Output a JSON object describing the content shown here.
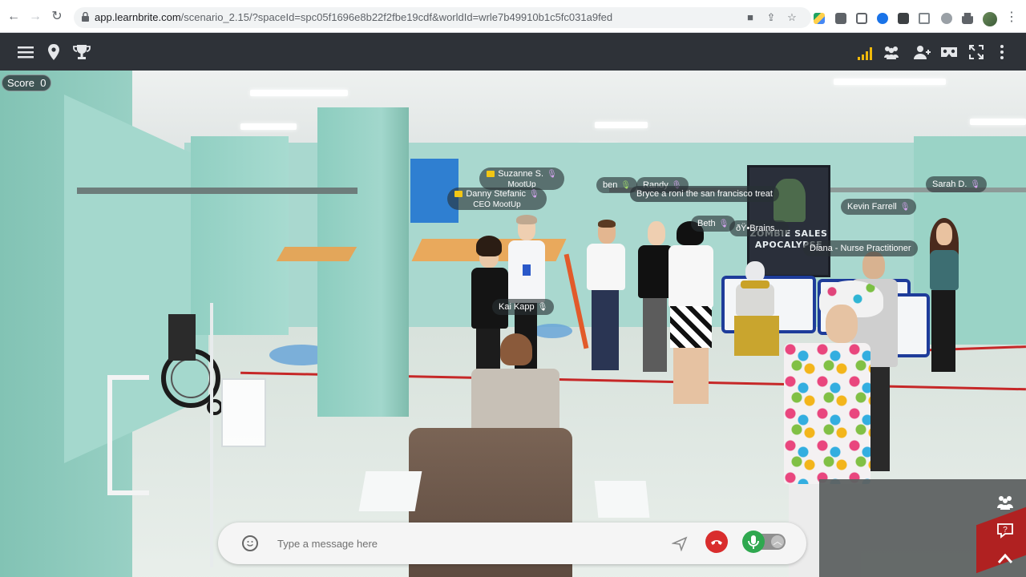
{
  "browser": {
    "url_host": "app.learnbrite.com",
    "url_rest": "/scenario_2.15/?spaceId=spc05f1696e8b22f2fbe19cdf&worldId=wrle7b49910b1c5fc031a9fed",
    "icons": [
      "back-arrow-icon",
      "forward-arrow-icon",
      "reload-icon",
      "lock-icon",
      "camera-icon",
      "share-icon",
      "star-icon",
      "google-drive-icon",
      "extension-icon",
      "puzzle-icon",
      "profile-avatar",
      "menu-dots-icon"
    ]
  },
  "toolbar": {
    "left_icons": [
      "hamburger-menu-icon",
      "location-pin-icon",
      "trophy-icon"
    ],
    "right_icons": [
      "signal-strength-icon",
      "people-icon",
      "add-user-icon",
      "vr-headset-icon",
      "fullscreen-icon",
      "more-vertical-icon"
    ],
    "signal_color": "#f0b90b"
  },
  "score": {
    "label": "Score",
    "value": "0"
  },
  "poster": {
    "line1": "ZOMBIE SALES",
    "line2": "APOCALYPSE"
  },
  "name_tags": [
    {
      "name": "Suzanne S.",
      "sub": "MootUp",
      "role": "host"
    },
    {
      "name": "Danny Stefanic",
      "sub": "CEO MootUp",
      "role": "host"
    },
    {
      "name": "ben"
    },
    {
      "name": "Randy"
    },
    {
      "name": "Bryce a roni the san francisco treat"
    },
    {
      "name": "Sarah D."
    },
    {
      "name": "Kevin Farrell"
    },
    {
      "name": "Beth"
    },
    {
      "name": "ðŸ•Brains..."
    },
    {
      "name": "Diana - Nurse Practitioner"
    },
    {
      "name": "Kai Kapp"
    }
  ],
  "chat": {
    "placeholder": "Type a message here",
    "icons": [
      "emoji-icon",
      "send-icon",
      "hangup-icon",
      "microphone-icon",
      "chevron-up-icon"
    ],
    "hangup_color": "#d92d2d",
    "mic_color": "#2fa84f"
  },
  "side_icons": [
    "group-icon",
    "help-icon",
    "chevron-up-icon"
  ]
}
